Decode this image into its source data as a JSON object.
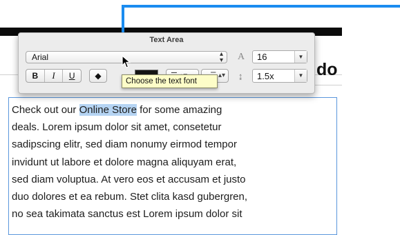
{
  "panel": {
    "title": "Text Area",
    "font": {
      "value": "Arial",
      "arrows_icon": "up-down-arrows-icon"
    },
    "font_size": {
      "value": "16",
      "icon": "font-size-icon",
      "dropdown_icon": "chevron-down-icon"
    },
    "format_buttons": {
      "bold": "B",
      "italic": "I",
      "underline": "U"
    },
    "text_color": {
      "value": "#151515"
    },
    "line_spacing": {
      "value": "1.5x",
      "icon": "line-spacing-icon",
      "dropdown_icon": "chevron-down-icon"
    }
  },
  "tooltip": {
    "text": "Choose the text font"
  },
  "page": {
    "heading_fragment": "do"
  },
  "text_area": {
    "before_selection": "Check out our ",
    "selected_text": "Online Store",
    "after_selection": " for some amazing\ndeals. Lorem ipsum dolor sit amet, consetetur\nsadipscing elitr, sed diam nonumy eirmod tempor\ninvidunt ut labore et dolore magna aliquyam erat,\nsed diam voluptua. At vero eos et accusam et justo\nduo dolores et ea rebum. Stet clita kasd gubergren,\nno sea takimata sanctus est Lorem ipsum dolor sit"
  },
  "colors": {
    "accent": "#1a8cf0",
    "selection": "#b5d4f3",
    "border": "#5a96dc"
  }
}
